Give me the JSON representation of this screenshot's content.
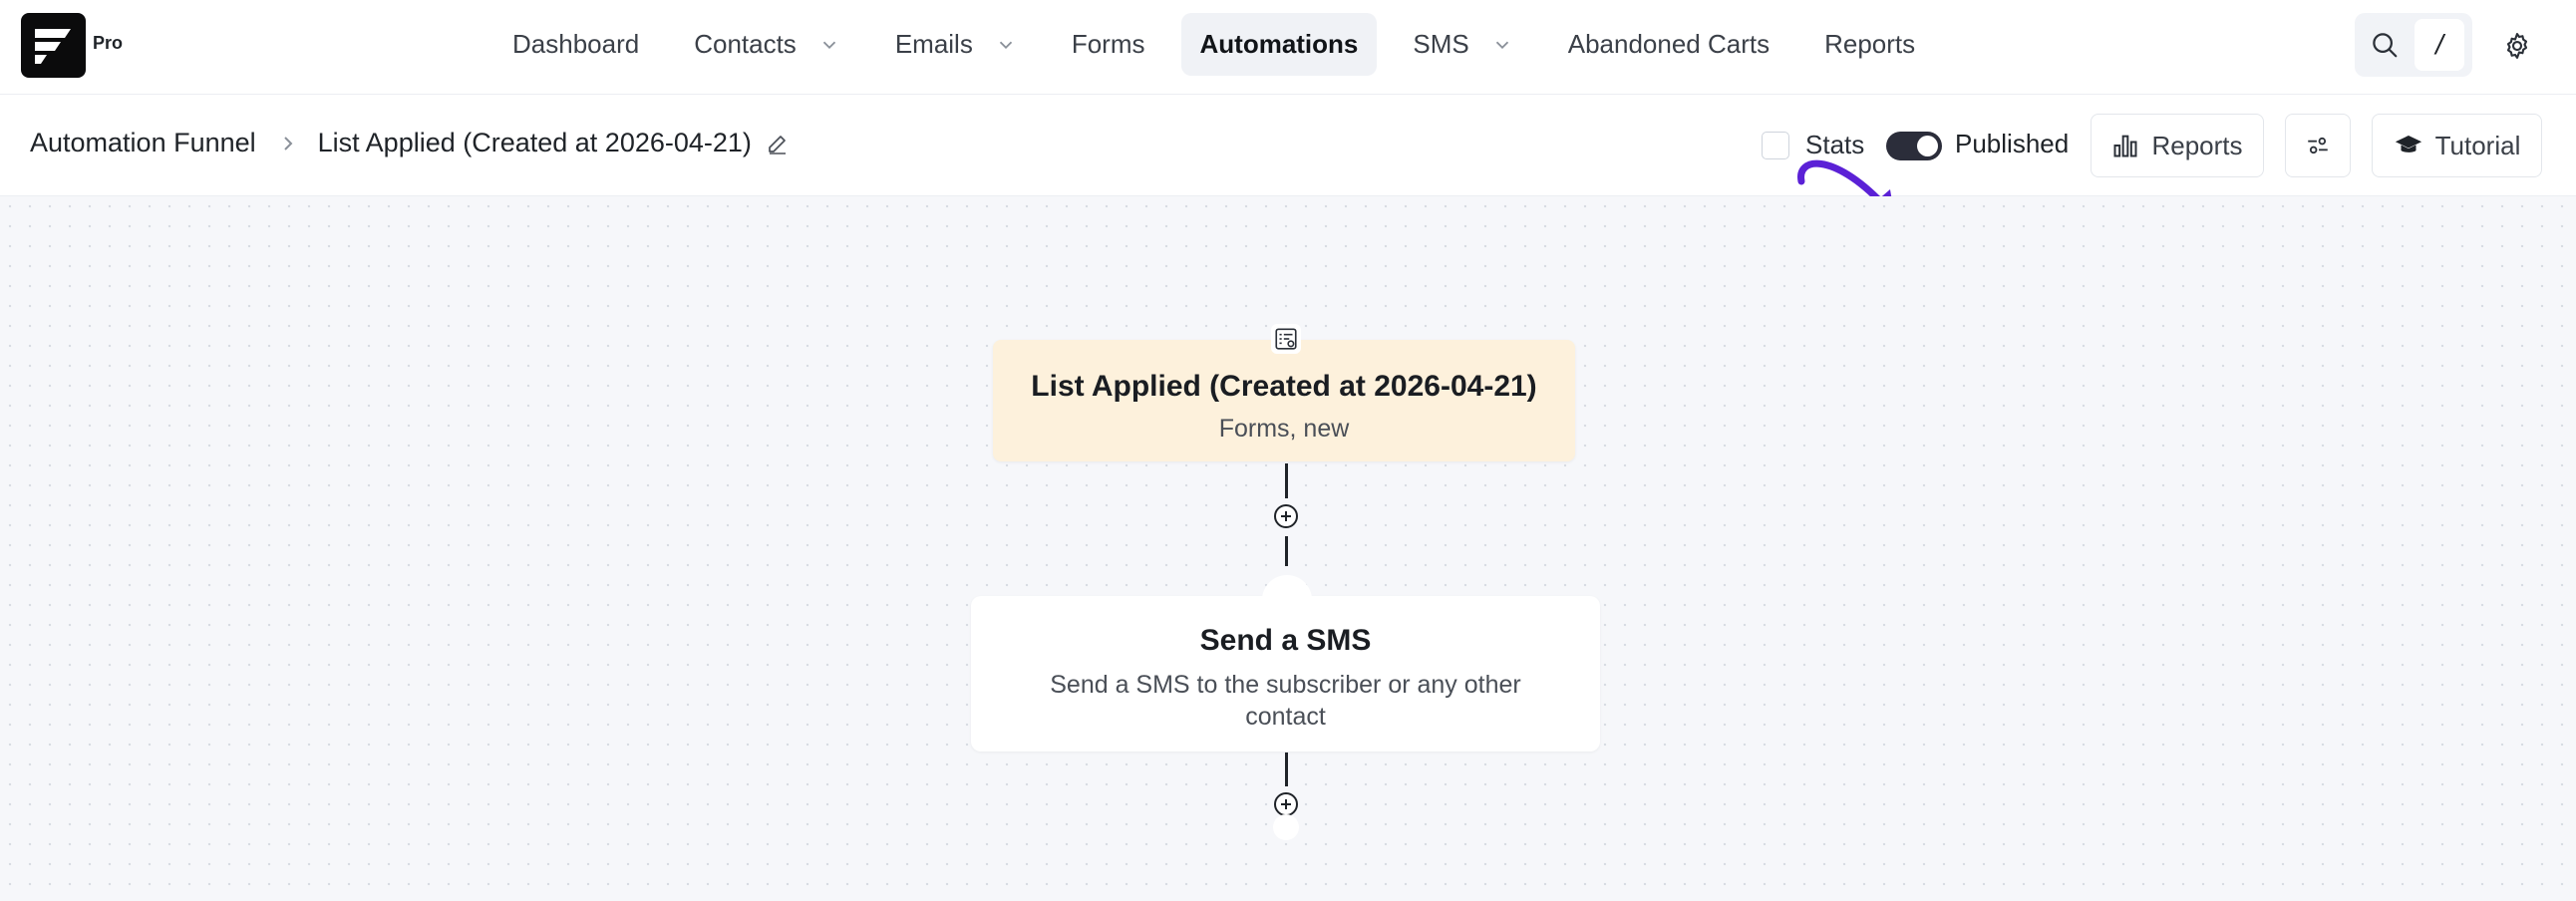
{
  "brand": {
    "badge": "Pro"
  },
  "nav": {
    "items": [
      {
        "label": "Dashboard",
        "dropdown": false,
        "active": false
      },
      {
        "label": "Contacts",
        "dropdown": true,
        "active": false
      },
      {
        "label": "Emails",
        "dropdown": true,
        "active": false
      },
      {
        "label": "Forms",
        "dropdown": false,
        "active": false
      },
      {
        "label": "Automations",
        "dropdown": false,
        "active": true
      },
      {
        "label": "SMS",
        "dropdown": true,
        "active": false
      },
      {
        "label": "Abandoned Carts",
        "dropdown": false,
        "active": false
      },
      {
        "label": "Reports",
        "dropdown": false,
        "active": false
      }
    ],
    "search_shortcut": "/",
    "icons": {
      "search": "search-icon",
      "settings": "gear-icon"
    }
  },
  "breadcrumb": {
    "root": "Automation Funnel",
    "current": "List Applied (Created at 2026-04-21)"
  },
  "controls": {
    "stats_label": "Stats",
    "stats_checked": false,
    "published_label": "Published",
    "published_on": true,
    "reports_label": "Reports",
    "tutorial_label": "Tutorial"
  },
  "funnel": {
    "trigger": {
      "title": "List Applied (Created at 2026-04-21)",
      "subtitle": "Forms, new"
    },
    "action": {
      "title": "Send a SMS",
      "description": "Send a SMS to the subscriber or any other contact"
    }
  },
  "colors": {
    "accent_arrow": "#5b21d6",
    "trigger_bg": "#fdf1dc",
    "toggle_on": "#2b2d3a",
    "canvas_bg": "#f6f7fa"
  }
}
